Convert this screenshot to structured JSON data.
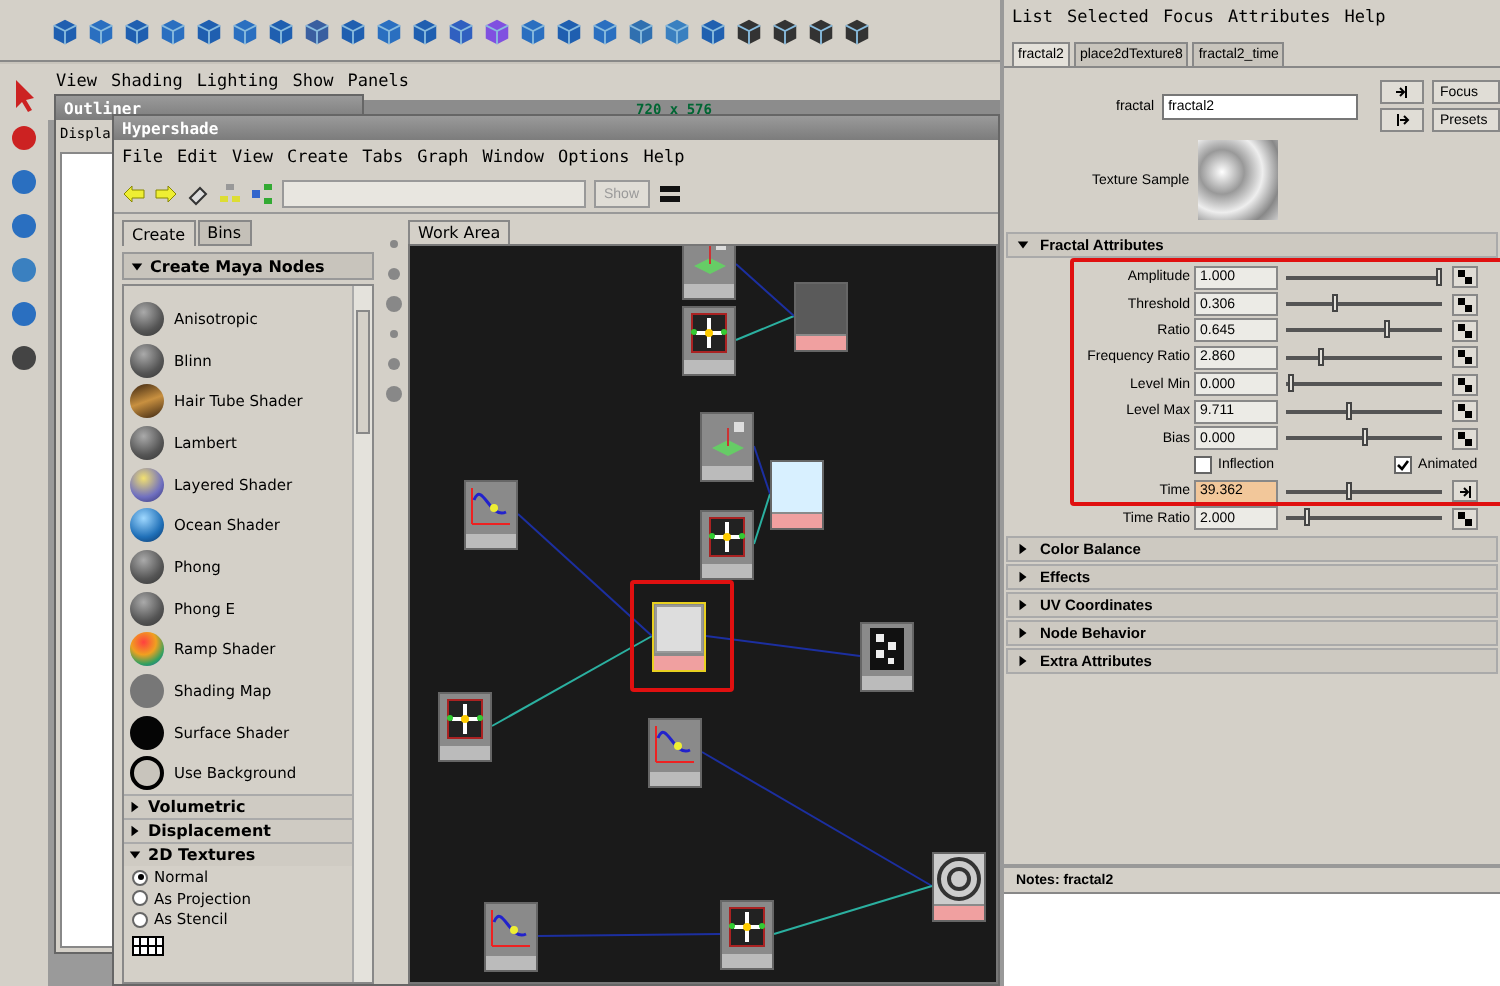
{
  "viewport": {
    "menu": [
      "View",
      "Shading",
      "Lighting",
      "Show",
      "Panels"
    ],
    "resolution": "720 x 576"
  },
  "outliner": {
    "title": "Outliner",
    "menu_partial": "Displa"
  },
  "hypershade": {
    "title": "Hypershade",
    "menu": [
      "File",
      "Edit",
      "View",
      "Create",
      "Tabs",
      "Graph",
      "Window",
      "Options",
      "Help"
    ],
    "show_button": "Show",
    "tabs": [
      {
        "label": "Create",
        "selected": true
      },
      {
        "label": "Bins",
        "selected": false
      }
    ],
    "create_panel": {
      "title": "Create Maya Nodes",
      "nodes": [
        {
          "label": "Anisotropic",
          "kind": "sphere"
        },
        {
          "label": "Blinn",
          "kind": "sphere"
        },
        {
          "label": "Hair Tube Shader",
          "kind": "hair"
        },
        {
          "label": "Lambert",
          "kind": "sphere"
        },
        {
          "label": "Layered Shader",
          "kind": "layered"
        },
        {
          "label": "Ocean Shader",
          "kind": "ocean"
        },
        {
          "label": "Phong",
          "kind": "sphere"
        },
        {
          "label": "Phong E",
          "kind": "sphere"
        },
        {
          "label": "Ramp Shader",
          "kind": "ramp"
        },
        {
          "label": "Shading Map",
          "kind": "flat"
        },
        {
          "label": "Surface Shader",
          "kind": "black"
        },
        {
          "label": "Use Background",
          "kind": "ring"
        }
      ],
      "sections": [
        {
          "label": "Volumetric",
          "expanded": false
        },
        {
          "label": "Displacement",
          "expanded": false
        },
        {
          "label": "2D Textures",
          "expanded": true
        }
      ],
      "texture_modes": [
        {
          "label": "Normal",
          "selected": true
        },
        {
          "label": "As Projection",
          "selected": false
        },
        {
          "label": "As Stencil",
          "selected": false
        }
      ]
    },
    "work_area": {
      "tab": "Work Area",
      "nodes": [
        {
          "kind": "place3d",
          "selected": false
        },
        {
          "kind": "place2d",
          "selected": false
        },
        {
          "kind": "ramp_dark",
          "selected": false
        },
        {
          "kind": "place3d",
          "selected": false
        },
        {
          "kind": "ramp_light",
          "selected": false
        },
        {
          "kind": "place2d",
          "selected": false
        },
        {
          "kind": "curve",
          "selected": false
        },
        {
          "kind": "fractal",
          "selected": true
        },
        {
          "kind": "checker",
          "selected": false
        },
        {
          "kind": "place2d",
          "selected": false
        },
        {
          "kind": "curve",
          "selected": false
        },
        {
          "kind": "ring",
          "selected": false
        },
        {
          "kind": "curve",
          "selected": false
        },
        {
          "kind": "place2d",
          "selected": false
        }
      ]
    }
  },
  "attribute_editor": {
    "menu": [
      "List",
      "Selected",
      "Focus",
      "Attributes",
      "Help"
    ],
    "tabs": [
      {
        "label": "fractal2",
        "selected": true
      },
      {
        "label": "place2dTexture8",
        "selected": false
      },
      {
        "label": "fractal2_time",
        "selected": false
      }
    ],
    "node_type": "fractal",
    "node_name": "fractal2",
    "buttons": [
      "Focus",
      "Presets"
    ],
    "sample_label": "Texture Sample",
    "section": {
      "label": "Fractal Attributes",
      "expanded": true
    },
    "rows": [
      {
        "kind": "slider",
        "label": "Amplitude",
        "value": "1.000",
        "level": 0.97,
        "keyed": false
      },
      {
        "kind": "slider",
        "label": "Threshold",
        "value": "0.306",
        "level": 0.31,
        "keyed": false
      },
      {
        "kind": "slider",
        "label": "Ratio",
        "value": "0.645",
        "level": 0.64,
        "keyed": false
      },
      {
        "kind": "slider",
        "label": "Frequency Ratio",
        "value": "2.860",
        "level": 0.22,
        "keyed": false
      },
      {
        "kind": "slider",
        "label": "Level Min",
        "value": "0.000",
        "level": 0.03,
        "keyed": false
      },
      {
        "kind": "slider",
        "label": "Level Max",
        "value": "9.711",
        "level": 0.4,
        "keyed": false
      },
      {
        "kind": "slider",
        "label": "Bias",
        "value": "0.000",
        "level": 0.5,
        "keyed": false
      },
      {
        "kind": "checks",
        "items": [
          {
            "label": "Inflection",
            "checked": false
          },
          {
            "label": "Animated",
            "checked": true
          }
        ]
      },
      {
        "kind": "slider",
        "label": "Time",
        "value": "39.362",
        "level": 0.4,
        "keyed": true
      },
      {
        "kind": "slider",
        "label": "Time Ratio",
        "value": "2.000",
        "level": 0.13,
        "keyed": false
      }
    ],
    "sections": [
      {
        "label": "Color Balance",
        "expanded": false
      },
      {
        "label": "Effects",
        "expanded": false
      },
      {
        "label": "UV Coordinates",
        "expanded": false
      },
      {
        "label": "Node Behavior",
        "expanded": false
      },
      {
        "label": "Extra Attributes",
        "expanded": false
      }
    ],
    "notes_title": "Notes: fractal2"
  }
}
